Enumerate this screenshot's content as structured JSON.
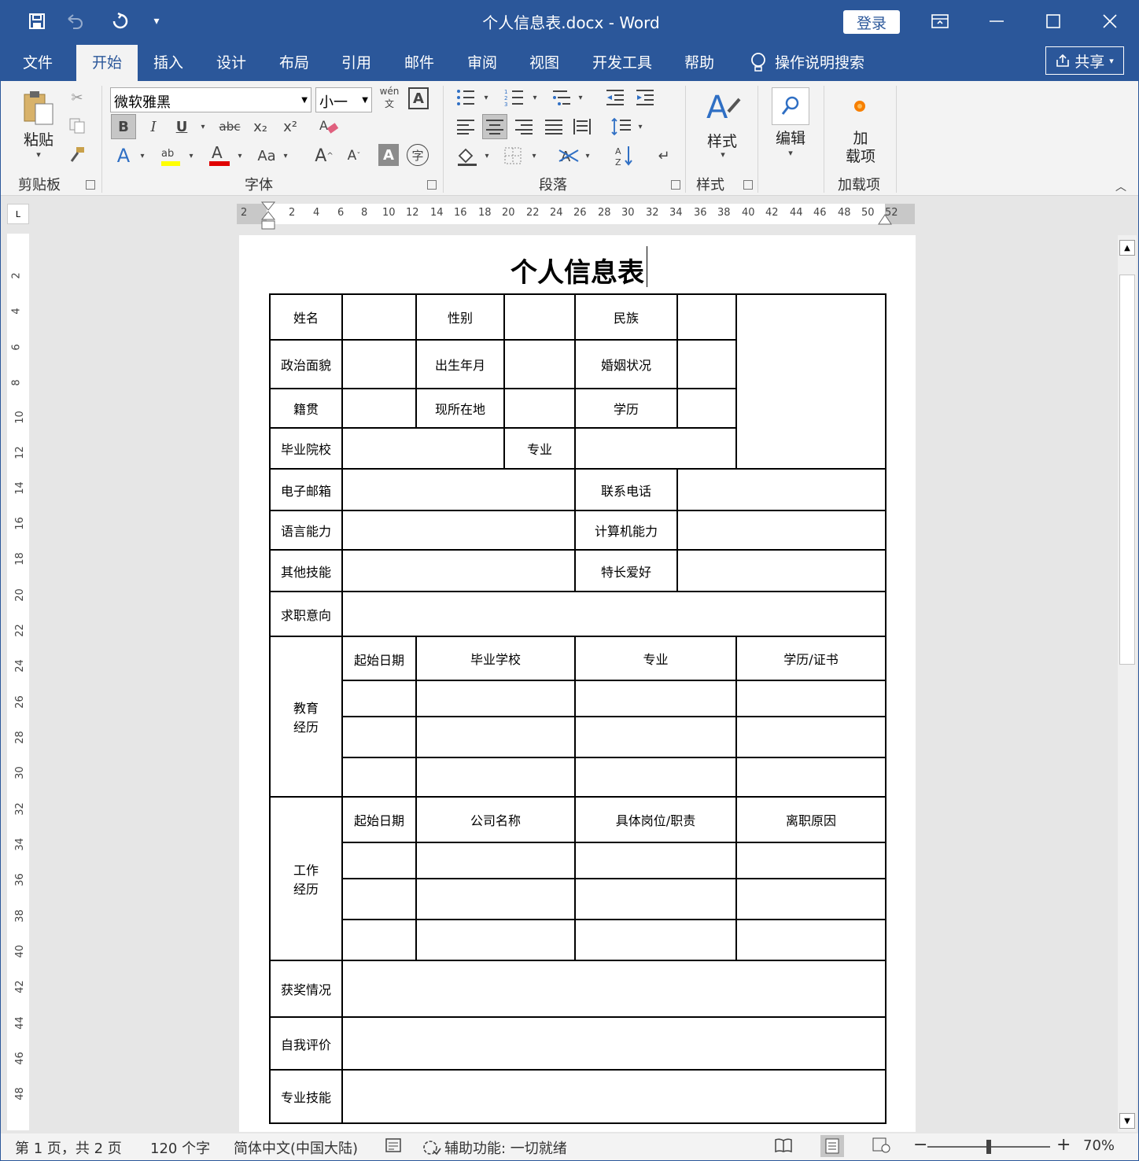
{
  "window": {
    "doc_title": "个人信息表.docx  -  Word",
    "login": "登录"
  },
  "tabs": [
    "文件",
    "开始",
    "插入",
    "设计",
    "布局",
    "引用",
    "邮件",
    "审阅",
    "视图",
    "开发工具",
    "帮助"
  ],
  "search_label": "操作说明搜索",
  "share": "共享",
  "ribbon": {
    "clipboard": {
      "paste": "粘贴",
      "label": "剪贴板"
    },
    "font": {
      "name": "微软雅黑",
      "size": "小一",
      "label": "字体",
      "bold": "B",
      "italic": "I",
      "underline": "U",
      "strike": "abc",
      "sub": "x₂",
      "sup": "x²",
      "case": "Aa",
      "grow": "A",
      "shrink": "A",
      "shade": "A",
      "phonetic": "wén",
      "border": "A",
      "encircle": "字"
    },
    "paragraph": {
      "label": "段落"
    },
    "styles": {
      "button": "样式",
      "label": "样式"
    },
    "editing": {
      "button": "编辑"
    },
    "addins": {
      "button": "加\n载项",
      "line1": "加",
      "line2": "载项",
      "label": "加载项"
    }
  },
  "ruler_h": [
    "2",
    "2",
    "4",
    "6",
    "8",
    "10",
    "12",
    "14",
    "16",
    "18",
    "20",
    "22",
    "24",
    "26",
    "28",
    "30",
    "32",
    "34",
    "36",
    "38",
    "40",
    "42",
    "44",
    "46",
    "48",
    "50",
    "52"
  ],
  "ruler_v": [
    "2",
    "4",
    "6",
    "8",
    "10",
    "12",
    "14",
    "16",
    "18",
    "20",
    "22",
    "24",
    "26",
    "28",
    "30",
    "32",
    "34",
    "36",
    "38",
    "40",
    "42",
    "44",
    "46",
    "48"
  ],
  "document": {
    "title": "个人信息表",
    "form": {
      "name": "姓名",
      "gender": "性别",
      "ethnicity": "民族",
      "political": "政治面貌",
      "birth": "出生年月",
      "marital": "婚姻状况",
      "native": "籍贯",
      "location": "现所在地",
      "education": "学历",
      "school": "毕业院校",
      "major": "专业",
      "email": "电子邮箱",
      "phone": "联系电话",
      "language": "语言能力",
      "computer": "计算机能力",
      "other_skills": "其他技能",
      "hobbies": "特长爱好",
      "job_intent": "求职意向",
      "edu_exp": "教育\n经历",
      "edu_line1": "教育",
      "edu_line2": "经历",
      "edu_headers": [
        "起始日期",
        "毕业学校",
        "专业",
        "学历/证书"
      ],
      "work_line1": "工作",
      "work_line2": "经历",
      "work_headers": [
        "起始日期",
        "公司名称",
        "具体岗位/职责",
        "离职原因"
      ],
      "awards": "获奖情况",
      "self_eval": "自我评价",
      "pro_skills": "专业技能"
    }
  },
  "status": {
    "page": "第 1 页，共 2 页",
    "words": "120 个字",
    "lang": "简体中文(中国大陆)",
    "access": "辅助功能: 一切就绪",
    "zoom": "70%",
    "zoom_level": 0.5
  },
  "colors": {
    "brand": "#2b579a"
  }
}
